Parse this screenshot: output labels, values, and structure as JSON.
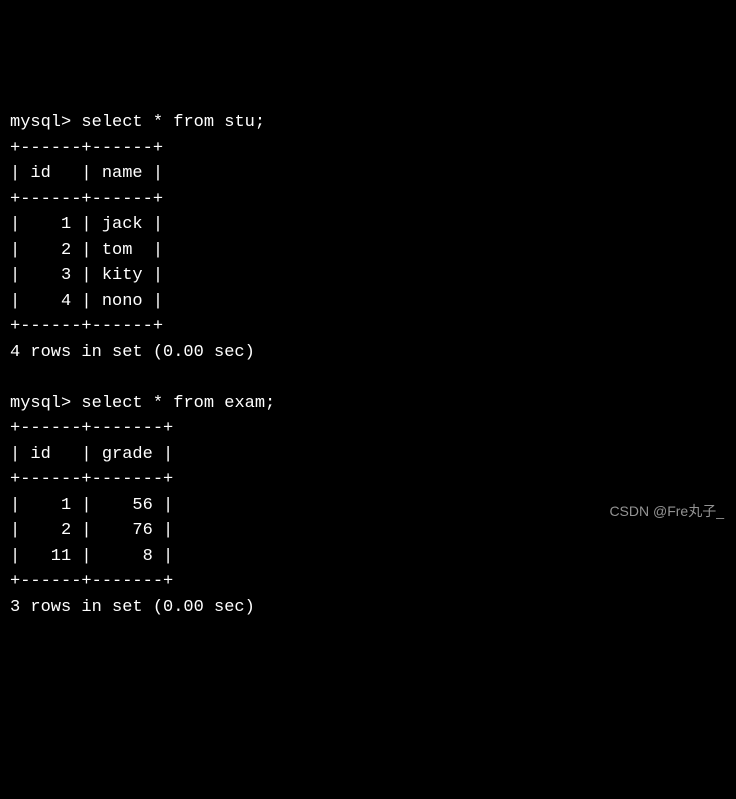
{
  "queries": [
    {
      "prompt": "mysql> ",
      "sql": "select * from stu;",
      "border_top": "+------+------+",
      "header_row": "| id   | name |",
      "border_mid": "+------+------+",
      "data_rows": [
        "|    1 | jack |",
        "|    2 | tom  |",
        "|    3 | kity |",
        "|    4 | nono |"
      ],
      "border_bot": "+------+------+",
      "summary": "4 rows in set (0.00 sec)",
      "columns": [
        "id",
        "name"
      ],
      "records": [
        {
          "id": 1,
          "name": "jack"
        },
        {
          "id": 2,
          "name": "tom"
        },
        {
          "id": 3,
          "name": "kity"
        },
        {
          "id": 4,
          "name": "nono"
        }
      ]
    },
    {
      "prompt": "mysql> ",
      "sql": "select * from exam;",
      "border_top": "+------+-------+",
      "header_row": "| id   | grade |",
      "border_mid": "+------+-------+",
      "data_rows": [
        "|    1 |    56 |",
        "|    2 |    76 |",
        "|   11 |     8 |"
      ],
      "border_bot": "+------+-------+",
      "summary": "3 rows in set (0.00 sec)",
      "columns": [
        "id",
        "grade"
      ],
      "records": [
        {
          "id": 1,
          "grade": 56
        },
        {
          "id": 2,
          "grade": 76
        },
        {
          "id": 11,
          "grade": 8
        }
      ]
    }
  ],
  "watermark": "CSDN @Fre丸子_"
}
